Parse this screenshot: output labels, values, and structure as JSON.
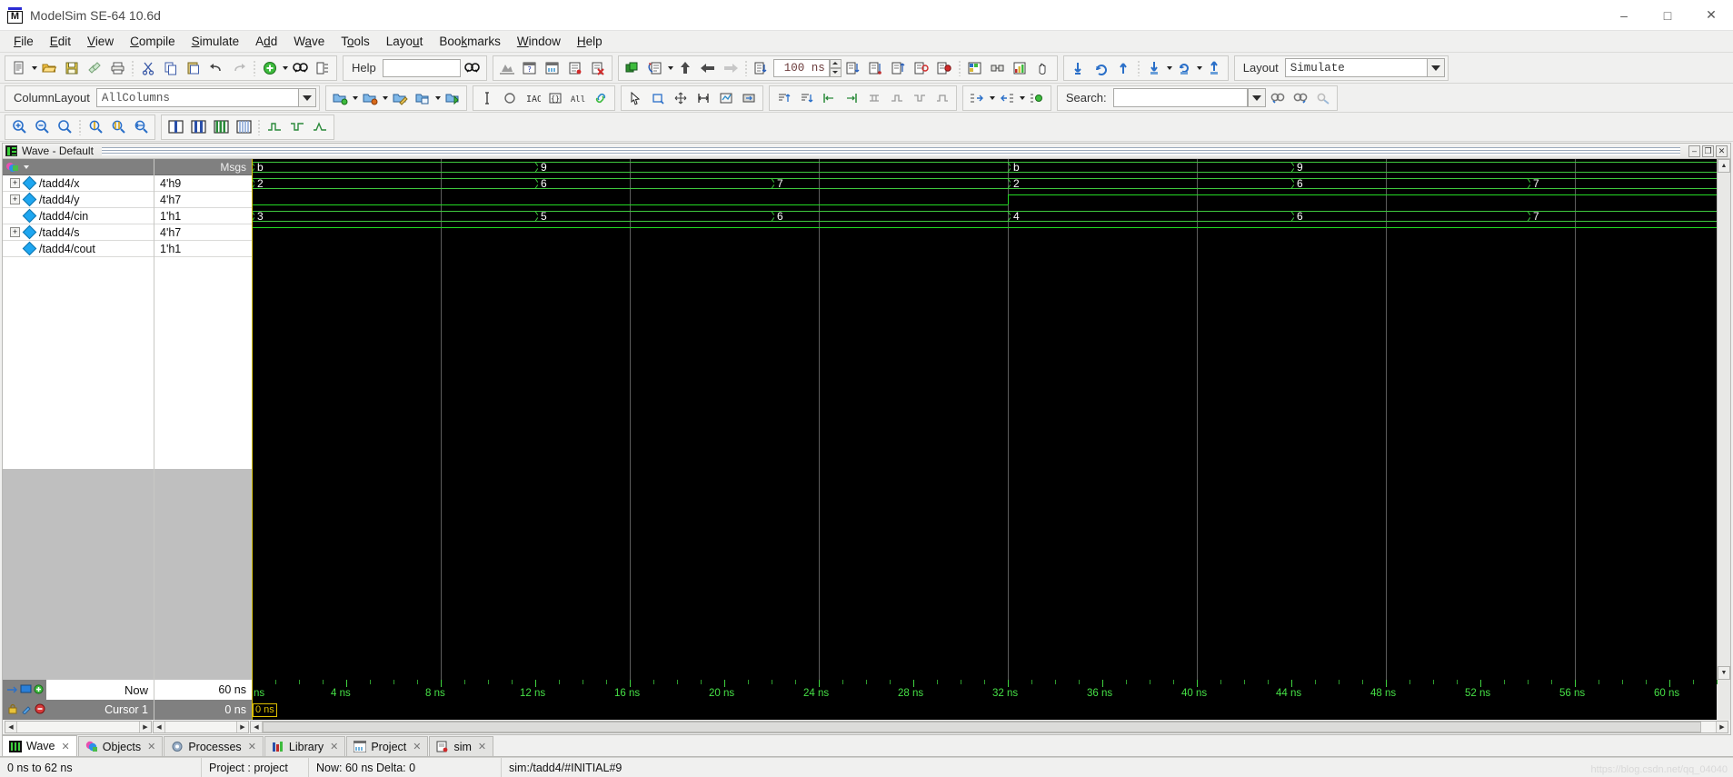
{
  "window": {
    "title": "ModelSim SE-64 10.6d",
    "logo_letter": "M",
    "minimize": "–",
    "maximize": "□",
    "close": "✕"
  },
  "menubar": {
    "items": [
      {
        "label": "File",
        "accel": "F"
      },
      {
        "label": "Edit",
        "accel": "E"
      },
      {
        "label": "View",
        "accel": "V"
      },
      {
        "label": "Compile",
        "accel": "C"
      },
      {
        "label": "Simulate",
        "accel": "S"
      },
      {
        "label": "Add",
        "accel": "d"
      },
      {
        "label": "Wave",
        "accel": "a"
      },
      {
        "label": "Tools",
        "accel": "o"
      },
      {
        "label": "Layout",
        "accel": "u"
      },
      {
        "label": "Bookmarks",
        "accel": "k"
      },
      {
        "label": "Window",
        "accel": "W"
      },
      {
        "label": "Help",
        "accel": "H"
      }
    ]
  },
  "toolbar1": {
    "help_label": "Help",
    "help_value": "",
    "run_length_value": "100 ns",
    "layout_label": "Layout",
    "layout_value": "Simulate",
    "icons": [
      "new-file-icon",
      "open-folder-icon",
      "save-icon",
      "reload-icon",
      "print-icon",
      "cut-icon",
      "copy-icon",
      "paste-icon",
      "undo-icon",
      "redo-icon",
      "add-icon",
      "find-icon",
      "properties-icon",
      "find-next-icon",
      "compile-icon",
      "compile-all-icon",
      "simulate-icon",
      "end-simulation-icon",
      "restart-icon",
      "run-icon",
      "continue-run-icon",
      "run-all-icon",
      "break-icon",
      "step-icon",
      "step-over-icon",
      "step-out-icon",
      "step-into-icon",
      "memory-icon",
      "coverage-icon",
      "hand-icon",
      "insert-cursor-icon",
      "reload-waves-icon",
      "up-icon",
      "down-all-icon",
      "reload-all-icon",
      "up-all-icon"
    ]
  },
  "toolbar2": {
    "columnlayout_label": "ColumnLayout",
    "columnlayout_value": "AllColumns",
    "search_label": "Search:",
    "search_value": "",
    "search_placeholder": "",
    "icons": [
      "open-dataset-icon",
      "close-dataset-icon",
      "edit-dataset-icon",
      "save-dataset-icon",
      "new-dataset-icon",
      "text-cursor-icon",
      "circle-icon",
      "radix-icon",
      "group-icon",
      "all-icon",
      "link-icon",
      "select-mode-icon",
      "zoom-mode-icon",
      "pan-mode-icon",
      "measure-icon",
      "edit-mode-icon",
      "expand-icon",
      "sort-up-icon",
      "sort-down-icon",
      "align-left-icon",
      "align-right-icon",
      "distribute-icon",
      "wave-edit-icon",
      "wave-insert-icon",
      "expand-all-icon",
      "collapse-all-icon",
      "toggle-icon",
      "find-prev-icon",
      "find-next-icon",
      "find-clear-icon"
    ]
  },
  "toolbar3": {
    "icons": [
      "zoom-in-icon",
      "zoom-out-icon",
      "zoom-full-icon",
      "zoom-cursor-icon",
      "zoom-range-icon",
      "zoom-last-icon",
      "view-single-icon",
      "view-split-icon",
      "view-columns-icon",
      "view-grid-icon",
      "wave-mode-1-icon",
      "wave-mode-2-icon",
      "wave-mode-3-icon"
    ]
  },
  "wave_window": {
    "title": "Wave - Default",
    "window_buttons": [
      "minimize-window-button",
      "restore-window-button",
      "close-window-button"
    ],
    "window_glyphs": [
      "–",
      "❐",
      "✕"
    ],
    "columns": {
      "name_header": "",
      "value_header": "Msgs"
    },
    "signals": [
      {
        "name": "/tadd4/x",
        "value": "4'h9",
        "expandable": true,
        "kind": "bus"
      },
      {
        "name": "/tadd4/y",
        "value": "4'h7",
        "expandable": true,
        "kind": "bus"
      },
      {
        "name": "/tadd4/cin",
        "value": "1'h1",
        "expandable": false,
        "kind": "bit"
      },
      {
        "name": "/tadd4/s",
        "value": "4'h7",
        "expandable": true,
        "kind": "bus"
      },
      {
        "name": "/tadd4/cout",
        "value": "1'h1",
        "expandable": false,
        "kind": "bit"
      }
    ],
    "now_label": "Now",
    "now_value": "60 ns",
    "cursor_label": "Cursor 1",
    "cursor_value": "0 ns",
    "cursor_badge": "0 ns",
    "cursor_time_ns": 0
  },
  "chart_data": {
    "type": "table",
    "title": "Wave - Default",
    "xlabel": "time",
    "x_unit": "ns",
    "xlim": [
      0,
      62
    ],
    "visible_range_ns": [
      0,
      62
    ],
    "major_tick_step_ns": 4,
    "minor_ticks_per_major": 4,
    "tick_labels": [
      "ns",
      "4 ns",
      "8 ns",
      "12 ns",
      "16 ns",
      "20 ns",
      "24 ns",
      "28 ns",
      "32 ns",
      "36 ns",
      "40 ns",
      "44 ns",
      "48 ns",
      "52 ns",
      "56 ns",
      "60 ns"
    ],
    "tick_values_ns": [
      0,
      4,
      8,
      12,
      16,
      20,
      24,
      28,
      32,
      36,
      40,
      44,
      48,
      52,
      56,
      60
    ],
    "grid": true,
    "grid_step_ns": 8,
    "waveform_colors": {
      "bus": "#3ec93e",
      "bit": "#23d923",
      "cursor": "#d8c100",
      "grid": "#5d5d5d",
      "background": "#000000"
    },
    "series": [
      {
        "name": "/tadd4/x",
        "kind": "bus",
        "radix": "hex",
        "transitions": [
          {
            "t": 0,
            "value": "b"
          },
          {
            "t": 12,
            "value": "9"
          },
          {
            "t": 32,
            "value": "b"
          },
          {
            "t": 44,
            "value": "9"
          }
        ]
      },
      {
        "name": "/tadd4/y",
        "kind": "bus",
        "radix": "hex",
        "transitions": [
          {
            "t": 0,
            "value": "2"
          },
          {
            "t": 12,
            "value": "6"
          },
          {
            "t": 22,
            "value": "7"
          },
          {
            "t": 32,
            "value": "2"
          },
          {
            "t": 44,
            "value": "6"
          },
          {
            "t": 54,
            "value": "7"
          }
        ]
      },
      {
        "name": "/tadd4/cin",
        "kind": "bit",
        "radix": "binary",
        "transitions": [
          {
            "t": 0,
            "value": "0"
          },
          {
            "t": 32,
            "value": "1"
          }
        ]
      },
      {
        "name": "/tadd4/s",
        "kind": "bus",
        "radix": "hex",
        "transitions": [
          {
            "t": 0,
            "value": "3"
          },
          {
            "t": 12,
            "value": "5"
          },
          {
            "t": 22,
            "value": "6"
          },
          {
            "t": 32,
            "value": "4"
          },
          {
            "t": 44,
            "value": "6"
          },
          {
            "t": 54,
            "value": "7"
          }
        ]
      },
      {
        "name": "/tadd4/cout",
        "kind": "bit",
        "radix": "binary",
        "transitions": [
          {
            "t": 0,
            "value": "1"
          }
        ]
      }
    ]
  },
  "tabs": [
    {
      "label": "Wave",
      "icon": "wave-tab-icon",
      "active": true,
      "close": "✕"
    },
    {
      "label": "Objects",
      "icon": "objects-tab-icon",
      "active": false,
      "close": "✕"
    },
    {
      "label": "Processes",
      "icon": "processes-tab-icon",
      "active": false,
      "close": "✕"
    },
    {
      "label": "Library",
      "icon": "library-tab-icon",
      "active": false,
      "close": "✕"
    },
    {
      "label": "Project",
      "icon": "project-tab-icon",
      "active": false,
      "close": "✕"
    },
    {
      "label": "sim",
      "icon": "sim-tab-icon",
      "active": false,
      "close": "✕"
    }
  ],
  "statusbar": {
    "range": "0 ns to 62 ns",
    "project": "Project : project",
    "now_delta": "Now: 60 ns  Delta: 0",
    "context": "sim:/tadd4/#INITIAL#9"
  }
}
